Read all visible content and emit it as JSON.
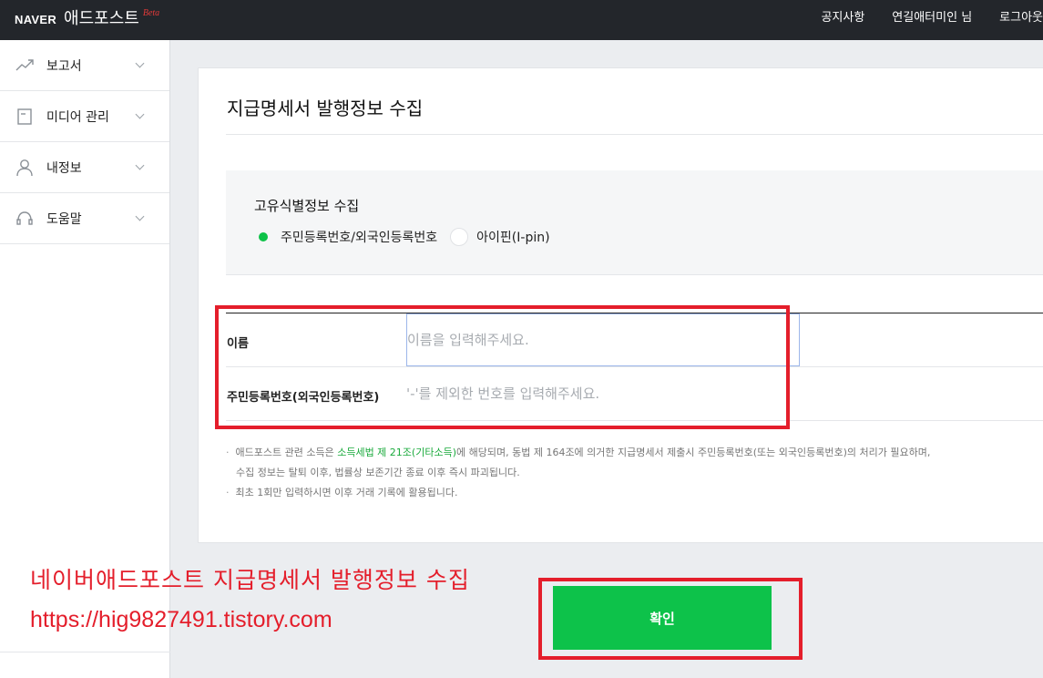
{
  "topbar": {
    "naver": "NAVER",
    "app_name": "애드포스트",
    "beta": "Beta",
    "nav": [
      "공지사항",
      "연길애터미인 님",
      "로그아웃"
    ]
  },
  "sidebar": {
    "items": [
      {
        "label": "보고서",
        "icon": "chart-line-icon"
      },
      {
        "label": "미디어 관리",
        "icon": "document-icon"
      },
      {
        "label": "내정보",
        "icon": "person-icon"
      },
      {
        "label": "도움말",
        "icon": "headset-icon"
      }
    ]
  },
  "page": {
    "title": "지급명세서 발행정보 수집",
    "ident_title": "고유식별정보 수집",
    "radio_options": [
      {
        "label": "주민등록번호/외국인등록번호",
        "selected": true
      },
      {
        "label": "아이핀(I-pin)",
        "selected": false
      }
    ],
    "form": {
      "name_label": "이름",
      "name_placeholder": "이름을 입력해주세요.",
      "rrn_label": "주민등록번호(외국인등록번호)",
      "rrn_placeholder": "'-'를 제외한 번호를 입력해주세요."
    },
    "notes": {
      "note1_pre": "애드포스트 관련 소득은 ",
      "note1_link1": "소득세법 제 21조",
      "note1_link2": "(기타소득)",
      "note1_post": "에 해당되며, 동법 제 164조에 의거한 지급명세서 제출시 주민등록번호(또는 외국인등록번호)의 처리가 필요하며,",
      "note1_line2": "수집 정보는 탈퇴 이후, 법률상 보존기간 종료 이후 즉시 파괴됩니다.",
      "note2": "최초 1회만 입력하시면 이후 거래 기록에 활용됩니다."
    },
    "confirm_label": "확인"
  },
  "overlay": {
    "title": "네이버애드포스트 지급명세서 발행정보 수집",
    "url": "https://hig9827491.tistory.com"
  },
  "colors": {
    "accent_green": "#0dc24a",
    "highlight_red": "#e41e2b",
    "topbar": "#23262b"
  }
}
